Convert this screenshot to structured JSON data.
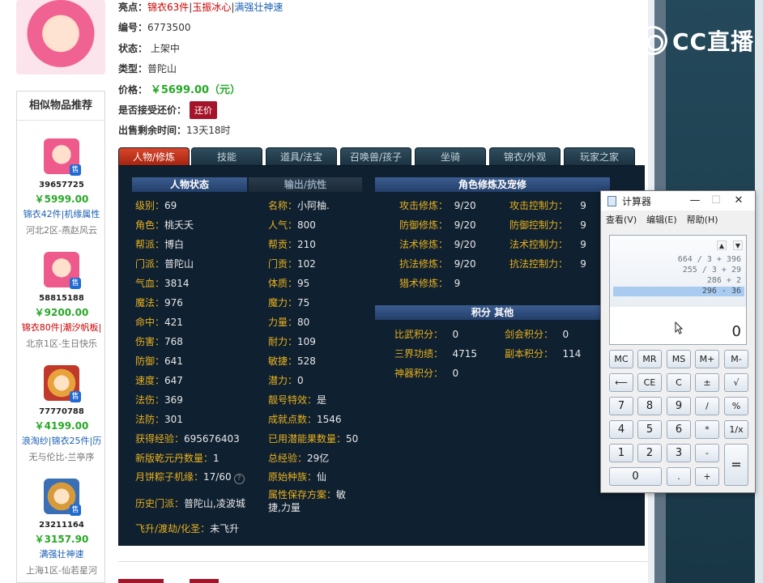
{
  "listing": {
    "highlights_label": "亮点：",
    "highlight_1": "锦衣63件",
    "highlight_2": "玉振冰心",
    "highlight_3": "满强壮神速",
    "sep": "|",
    "id_label": "编号：",
    "id_value": "6773500",
    "status_label": "状态：",
    "status_value": "上架中",
    "type_label": "类型：",
    "type_value": "普陀山",
    "price_label": "价格：",
    "price_value": "￥5699.00（元）",
    "bargain_label": "是否接受还价：",
    "bargain_button": "还价",
    "time_label": "出售剩余时间：",
    "time_value": "13天18时"
  },
  "similar": {
    "title": "相似物品推荐",
    "sale_badge": "售",
    "items": [
      {
        "id": "39657725",
        "price": "￥5999.00",
        "tags": "锦衣42件|机缘属性",
        "server": "河北2区-燕赵风云"
      },
      {
        "id": "58815188",
        "price": "￥9200.00",
        "tags": "锦衣80件|潮汐帆板|",
        "server": "北京1区-生日快乐"
      },
      {
        "id": "77770788",
        "price": "￥4199.00",
        "tags": "浪淘纱|锦衣25件|历",
        "server": "无与伦比-兰亭序"
      },
      {
        "id": "23211164",
        "price": "￥3157.90",
        "tags": "满强壮神速",
        "server": "上海1区-仙若星河"
      }
    ]
  },
  "tabs": [
    "人物/修炼",
    "技能",
    "道具/法宝",
    "召唤兽/孩子",
    "坐骑",
    "锦衣/外观",
    "玩家之家"
  ],
  "sections": {
    "status": "人物状态",
    "output": "输出/抗性",
    "cultivation": "角色修炼及宠修",
    "points": "积分 其他"
  },
  "left_stats": [
    {
      "k": "级别：",
      "v": "69"
    },
    {
      "k": "角色：",
      "v": "桃夭夭"
    },
    {
      "k": "帮派：",
      "v": "博白"
    },
    {
      "k": "门派：",
      "v": "普陀山"
    },
    {
      "k": "气血：",
      "v": "3814"
    },
    {
      "k": "魔法：",
      "v": "976"
    },
    {
      "k": "命中：",
      "v": "421"
    },
    {
      "k": "伤害：",
      "v": "768"
    },
    {
      "k": "防御：",
      "v": "641"
    },
    {
      "k": "速度：",
      "v": "647"
    },
    {
      "k": "法伤：",
      "v": "369"
    },
    {
      "k": "法防：",
      "v": "301"
    }
  ],
  "mid_stats": [
    {
      "k": "名称：",
      "v": "小阿柚."
    },
    {
      "k": "人气：",
      "v": "800"
    },
    {
      "k": "帮贡：",
      "v": "210"
    },
    {
      "k": "门贡：",
      "v": "102"
    },
    {
      "k": "体质：",
      "v": "95"
    },
    {
      "k": "魔力：",
      "v": "75"
    },
    {
      "k": "力量：",
      "v": "80"
    },
    {
      "k": "耐力：",
      "v": "109"
    },
    {
      "k": "敏捷：",
      "v": "528"
    },
    {
      "k": "潜力：",
      "v": "0"
    },
    {
      "k": "靓号特效：",
      "v": "是"
    },
    {
      "k": "成就点数：",
      "v": "1546"
    }
  ],
  "extra_stats": {
    "exp_k": "获得经验：",
    "exp_v": "695676403",
    "used_k": "已用潜能果数量：",
    "used_v": "50",
    "qy_k": "新版乾元丹数量：",
    "qy_v": "1",
    "total_k": "总经验：",
    "total_v": "29亿",
    "zz_k": "月饼粽子机缘：",
    "zz_v": "17/60",
    "help_icon": "?",
    "race_k": "原始种族：",
    "race_v": "仙",
    "hist_k": "历史门派：",
    "hist_v": "普陀山,凌波城",
    "attr_k": "属性保存方案：",
    "attr_v1": "敏",
    "attr_v2": "捷,力量",
    "fly_k": "飞升/渡劫/化圣：",
    "fly_v": "未飞升"
  },
  "cultivation": [
    {
      "k": "攻击修炼：",
      "v": "9/20",
      "k2": "攻击控制力：",
      "v2": "9"
    },
    {
      "k": "防御修炼：",
      "v": "9/20",
      "k2": "防御控制力：",
      "v2": "9"
    },
    {
      "k": "法术修炼：",
      "v": "9/20",
      "k2": "法术控制力：",
      "v2": "9"
    },
    {
      "k": "抗法修炼：",
      "v": "9/20",
      "k2": "抗法控制力：",
      "v2": "9"
    },
    {
      "k": "猎术修炼：",
      "v": "9"
    }
  ],
  "points": [
    {
      "k": "比武积分：",
      "v": "0",
      "k2": "剑会积分：",
      "v2": "0"
    },
    {
      "k": "三界功绩：",
      "v": "4715",
      "k2": "副本积分：",
      "v2": "114"
    },
    {
      "k": "神器积分：",
      "v": "0"
    }
  ],
  "calculator": {
    "title": "计算器",
    "minimize": "—",
    "maximize": "☐",
    "close": "✕",
    "menu": [
      "查看(V)",
      "编辑(E)",
      "帮助(H)"
    ],
    "scroll_up": "▲",
    "scroll_down": "▼",
    "history": [
      "664 / 3 + 396",
      "255 / 3 + 29",
      "286 + 2",
      "296 - 36"
    ],
    "display_value": "0",
    "keys": [
      [
        "MC",
        "MR",
        "MS",
        "M+",
        "M-"
      ],
      [
        "⟵",
        "CE",
        "C",
        "±",
        "√"
      ],
      [
        "7",
        "8",
        "9",
        "/",
        "%"
      ],
      [
        "4",
        "5",
        "6",
        "*",
        "1/x"
      ],
      [
        "1",
        "2",
        "3",
        "-",
        "="
      ],
      [
        "0",
        ".",
        "+"
      ]
    ]
  },
  "watermark": {
    "text": "CC直播"
  }
}
